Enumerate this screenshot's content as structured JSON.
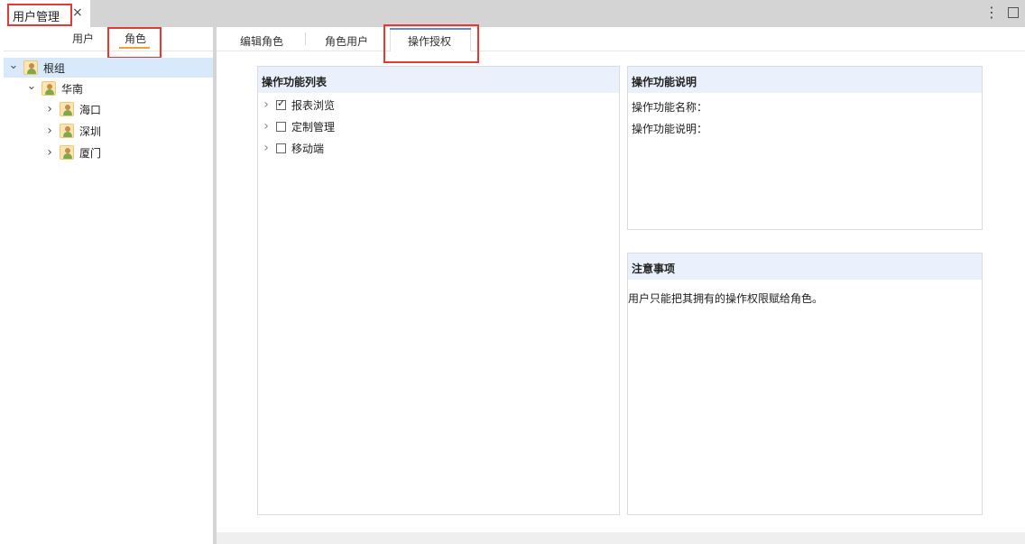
{
  "top_tab": {
    "title": "用户管理",
    "close_icon": "×"
  },
  "window_controls": {
    "menu_icon": "⋮"
  },
  "left_tabs": [
    {
      "label": "用户"
    },
    {
      "label": "角色"
    }
  ],
  "tree": [
    {
      "label": "根组",
      "level": 0,
      "expanded": true,
      "selected": true
    },
    {
      "label": "华南",
      "level": 1,
      "expanded": true
    },
    {
      "label": "海口",
      "level": 2,
      "expanded": false
    },
    {
      "label": "深圳",
      "level": 2,
      "expanded": false
    },
    {
      "label": "厦门",
      "level": 2,
      "expanded": false
    }
  ],
  "main_tabs": [
    {
      "label": "编辑角色"
    },
    {
      "label": "角色用户"
    },
    {
      "label": "操作授权"
    }
  ],
  "func_panel": {
    "title": "操作功能列表",
    "items": [
      {
        "label": "报表浏览",
        "checked": true
      },
      {
        "label": "定制管理",
        "checked": false
      },
      {
        "label": "移动端",
        "checked": false
      }
    ]
  },
  "desc_panel": {
    "title": "操作功能说明",
    "name_label": "操作功能名称：",
    "desc_label": "操作功能说明："
  },
  "notes_panel": {
    "title": "注意事项",
    "text": "用户只能把其拥有的操作权限赋给角色。"
  },
  "colors": {
    "highlight_box": "#e53935",
    "selected_row": "#d7e9fb",
    "panel_header": "#eaf1fc",
    "active_underline": "#f0a13a"
  }
}
